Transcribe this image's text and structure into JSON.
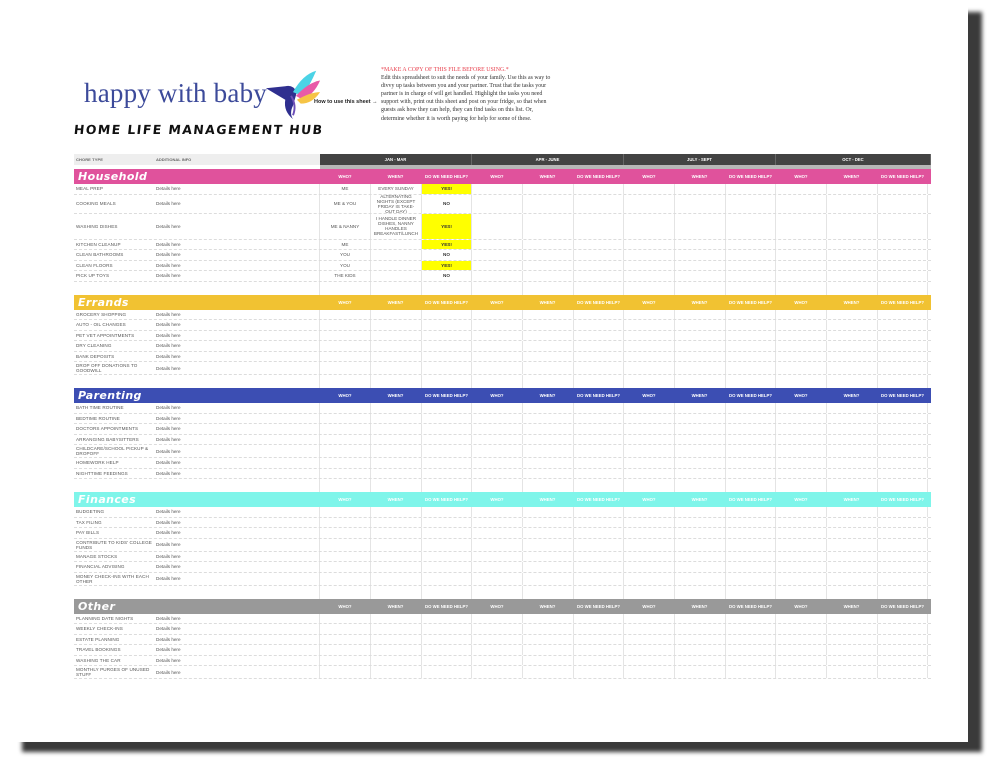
{
  "header": {
    "brand": "happy with baby",
    "hub_title": "HOME LIFE MANAGEMENT HUB",
    "how_to_label": "How to use this sheet →",
    "notes_warning": "*MAKE A COPY OF THIS FILE BEFORE USING.*",
    "notes_body": "Edit this spreadsheet to suit the needs of your family. Use this as way to divvy up tasks between you and your partner. Trust that the tasks your partner is in charge of will get handled. Highlight the tasks you need support with, print out this sheet and post on your fridge, so that when guests ask how they can help, they can find tasks on this list. Or, determine whether it is worth paying for help for some of these."
  },
  "columns": {
    "chore_type": "CHORE TYPE",
    "additional_info": "ADDITIONAL INFO",
    "quarters": [
      "JAN - MAR",
      "APR - JUNE",
      "JULY - SEPT",
      "OCT - DEC"
    ],
    "sub": [
      "WHO?",
      "WHEN?",
      "DO WE NEED HELP?"
    ]
  },
  "colors": {
    "household": "#e0529c",
    "errands": "#f1c232",
    "parenting": "#3c4eb3",
    "finances": "#7ff5ea",
    "other": "#999999",
    "yes_highlight": "#ffff00",
    "quarter_bar": "#434343"
  },
  "sections": [
    {
      "title": "Household",
      "rows": [
        {
          "chore": "MEAL PREP",
          "info": "Details here",
          "who": "ME",
          "when": "EVERY SUNDAY",
          "help": "YES!"
        },
        {
          "chore": "COOKING MEALS",
          "info": "Details here",
          "who": "ME & YOU",
          "when": "ALTERNATING NIGHTS (EXCEPT FRIDAY IS TAKE-OUT DAY)",
          "help": "NO"
        },
        {
          "chore": "WASHING DISHES",
          "info": "Details here",
          "who": "ME & NANNY",
          "when": "I HANDLE DINNER DISHES, NANNY HANDLES BREAKFAST/LUNCH",
          "help": "YES!"
        },
        {
          "chore": "KITCHEN CLEANUP",
          "info": "Details here",
          "who": "ME",
          "when": "",
          "help": "YES!"
        },
        {
          "chore": "CLEAN BATHROOMS",
          "info": "Details here",
          "who": "YOU",
          "when": "",
          "help": "NO"
        },
        {
          "chore": "CLEAN FLOORS",
          "info": "Details here",
          "who": "YOU",
          "when": "",
          "help": "YES!"
        },
        {
          "chore": "PICK UP TOYS",
          "info": "Details here",
          "who": "THE KIDS",
          "when": "",
          "help": "NO"
        }
      ]
    },
    {
      "title": "Errands",
      "rows": [
        {
          "chore": "GROCERY SHOPPING",
          "info": "Details here"
        },
        {
          "chore": "AUTO - OIL CHANGES",
          "info": "Details here"
        },
        {
          "chore": "PET VET APPOINTMENTS",
          "info": "Details here"
        },
        {
          "chore": "DRY CLEANING",
          "info": "Details here"
        },
        {
          "chore": "BANK DEPOSITS",
          "info": "Details here"
        },
        {
          "chore": "DROP OFF DONATIONS TO GOODWILL",
          "info": "Details here"
        }
      ]
    },
    {
      "title": "Parenting",
      "rows": [
        {
          "chore": "BATH TIME ROUTINE",
          "info": "Details here"
        },
        {
          "chore": "BEDTIME ROUTINE",
          "info": "Details here"
        },
        {
          "chore": "DOCTORS APPOINTMENTS",
          "info": "Details here"
        },
        {
          "chore": "ARRANGING BABYSITTERS",
          "info": "Details here"
        },
        {
          "chore": "CHILDCARE/SCHOOL PICKUP & DROPOFF",
          "info": "Details here"
        },
        {
          "chore": "HOMEWORK HELP",
          "info": "Details here"
        },
        {
          "chore": "NIGHTTIME FEEDINGS",
          "info": "Details here"
        }
      ]
    },
    {
      "title": "Finances",
      "rows": [
        {
          "chore": "BUDGETING",
          "info": "Details here"
        },
        {
          "chore": "TAX FILING",
          "info": "Details here"
        },
        {
          "chore": "PAY BILLS",
          "info": "Details here"
        },
        {
          "chore": "CONTRIBUTE TO KIDS' COLLEGE FUNDS",
          "info": "Details here"
        },
        {
          "chore": "MANAGE STOCKS",
          "info": "Details here"
        },
        {
          "chore": "FINANCIAL ADVISING",
          "info": "Details here"
        },
        {
          "chore": "MONEY CHECK-INS WITH EACH OTHER",
          "info": "Details here"
        }
      ]
    },
    {
      "title": "Other",
      "rows": [
        {
          "chore": "PLANNING DATE NIGHTS",
          "info": "Details here"
        },
        {
          "chore": "WEEKLY CHECK-INS",
          "info": "Details here"
        },
        {
          "chore": "ESTATE PLANNING",
          "info": "Details here"
        },
        {
          "chore": "TRAVEL BOOKINGS",
          "info": "Details here"
        },
        {
          "chore": "WASHING THE CAR",
          "info": "Details here"
        },
        {
          "chore": "MONTHLY PURGES OF UNUSED STUFF",
          "info": "Details here"
        }
      ]
    }
  ]
}
